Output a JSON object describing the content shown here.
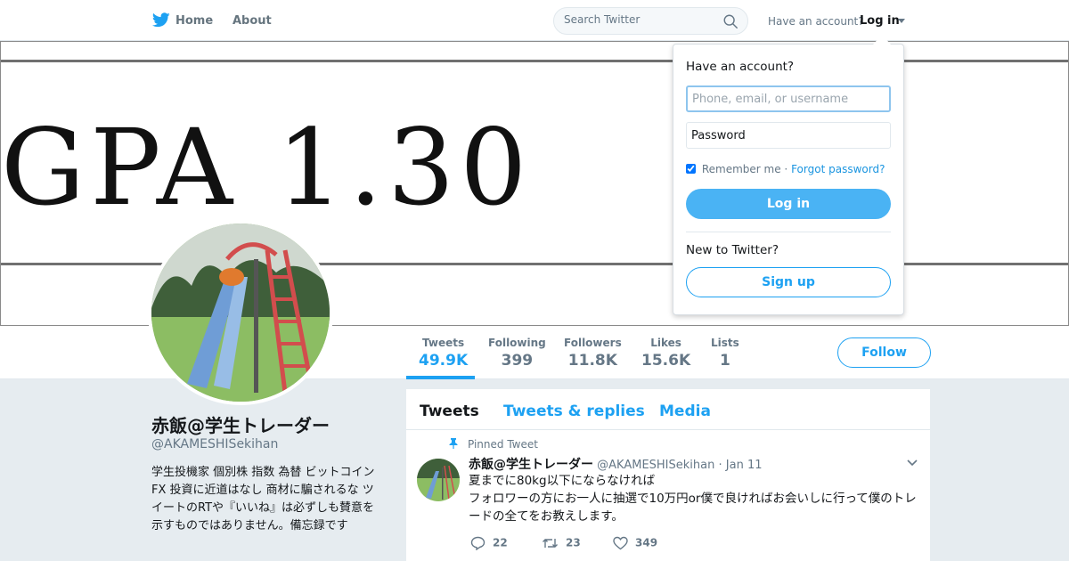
{
  "nav": {
    "home_label": "Home",
    "about_label": "About",
    "search_placeholder": "Search Twitter",
    "have_account_text": "Have an account?",
    "login_label": "Log in"
  },
  "banner": {
    "text": "GPA 1.30"
  },
  "stats": [
    {
      "label": "Tweets",
      "value": "49.9K"
    },
    {
      "label": "Following",
      "value": "399"
    },
    {
      "label": "Followers",
      "value": "11.8K"
    },
    {
      "label": "Likes",
      "value": "15.6K"
    },
    {
      "label": "Lists",
      "value": "1"
    }
  ],
  "follow_label": "Follow",
  "profile": {
    "name": "赤飯@学生トレーダー",
    "handle": "@AKAMESHISekihan",
    "bio": "学生投機家 個別株 指数 為替 ビットコインFX 投資に近道はなし 商材に騙されるな ツイートのRTや『いいね』は必ずしも賛意を示すものではありません。備忘録です"
  },
  "timeline": {
    "tabs": [
      "Tweets",
      "Tweets & replies",
      "Media"
    ],
    "pinned_label": "Pinned Tweet",
    "tweet": {
      "name": "赤飯@学生トレーダー",
      "handle": "@AKAMESHISekihan",
      "separator": "·",
      "date": "Jan 11",
      "text": "夏までに80kg以下にならなければ\nフォロワーの方にお一人に抽選で10万円or僕で良ければお会いしに行って僕のトレードの全てをお教えします。",
      "replies": "22",
      "retweets": "23",
      "likes": "349"
    }
  },
  "login_dropdown": {
    "heading": "Have an account?",
    "username_placeholder": "Phone, email, or username",
    "password_placeholder": "Password",
    "remember_label": "Remember me",
    "separator": "·",
    "forgot_label": "Forgot password?",
    "login_button": "Log in",
    "new_heading": "New to Twitter?",
    "signup_button": "Sign up"
  },
  "colors": {
    "accent": "#1da1f2",
    "background": "#e6ecf0",
    "login_button": "#4ab3f4"
  }
}
